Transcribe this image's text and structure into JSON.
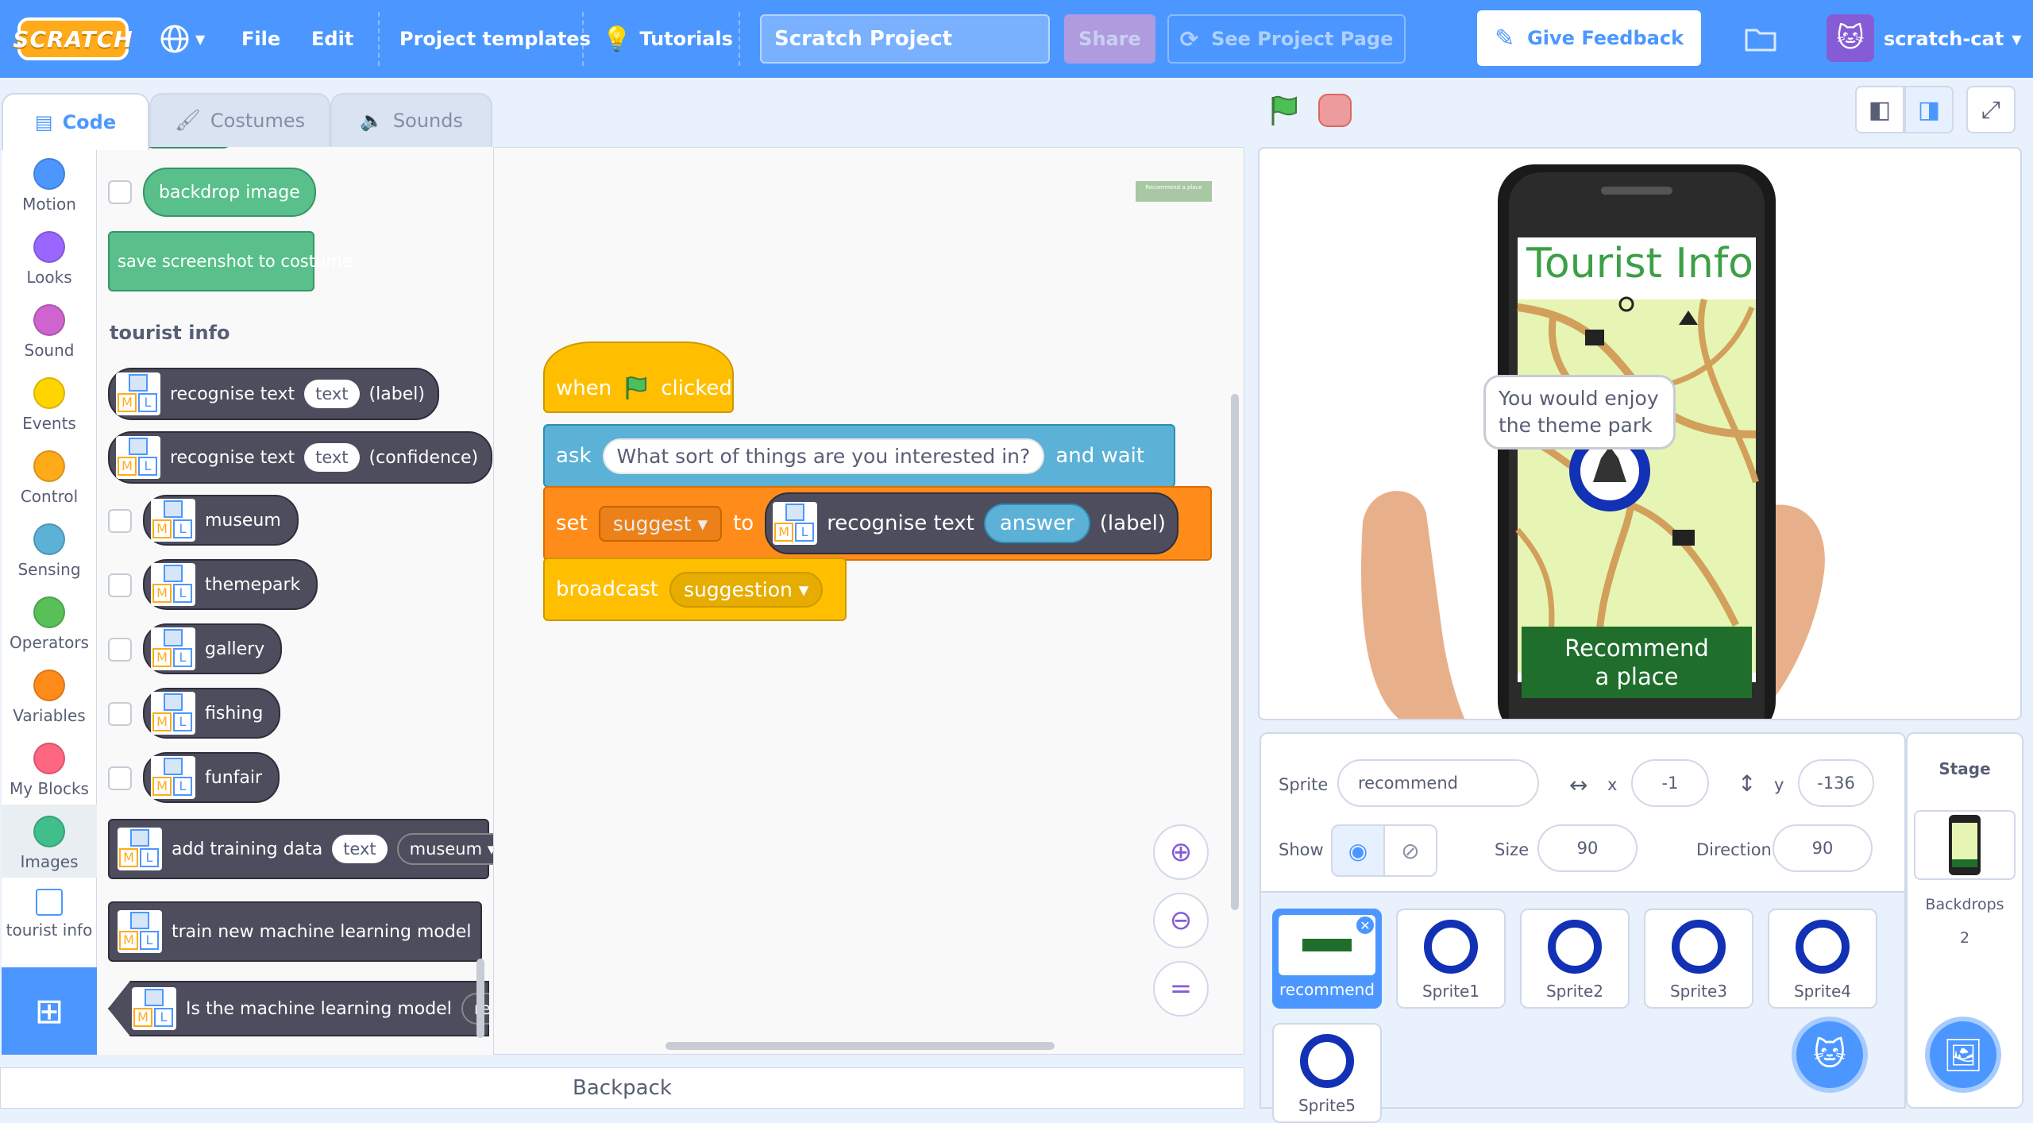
{
  "menubar": {
    "logo": "SCRATCH",
    "file": "File",
    "edit": "Edit",
    "templates": "Project templates",
    "tutorials": "Tutorials",
    "project_title": "Scratch Project",
    "share": "Share",
    "see_project": "See Project Page",
    "feedback": "Give Feedback",
    "username": "scratch-cat"
  },
  "tabs": {
    "code": "Code",
    "costumes": "Costumes",
    "sounds": "Sounds"
  },
  "categories": [
    {
      "label": "Motion",
      "color": "#4c97ff"
    },
    {
      "label": "Looks",
      "color": "#9966ff"
    },
    {
      "label": "Sound",
      "color": "#cf63cf"
    },
    {
      "label": "Events",
      "color": "#ffd500"
    },
    {
      "label": "Control",
      "color": "#ffab19"
    },
    {
      "label": "Sensing",
      "color": "#5cb1d6"
    },
    {
      "label": "Operators",
      "color": "#59c059"
    },
    {
      "label": "Variables",
      "color": "#ff8c1a"
    },
    {
      "label": "My Blocks",
      "color": "#ff6680"
    },
    {
      "label": "Images",
      "color": "#40bf8c"
    },
    {
      "label": "tourist info",
      "color": "#4d4d5e"
    }
  ],
  "palette": {
    "backdrop_image": "backdrop image",
    "save_screenshot": "save screenshot to costume",
    "heading": "tourist info",
    "recognise_label": "recognise text",
    "recognise_input": "text",
    "label_suffix": "(label)",
    "confidence_suffix": "(confidence)",
    "labels": [
      "museum",
      "themepark",
      "gallery",
      "fishing",
      "funfair"
    ],
    "add_training": "add training data",
    "add_training_text": "text",
    "add_training_label": "museum",
    "train_model": "train new machine learning model",
    "is_model": "Is the machine learning model",
    "is_model_dd": "read"
  },
  "script": {
    "hat_when": "when",
    "hat_clicked": "clicked",
    "ask": "ask",
    "ask_question": "What sort of things are you interested in?",
    "ask_wait": "and wait",
    "set": "set",
    "set_var": "suggest",
    "to": "to",
    "recognise": "recognise text",
    "answer": "answer",
    "label": "(label)",
    "broadcast": "broadcast",
    "broadcast_msg": "suggestion",
    "comment_thumb": "Recommend a place"
  },
  "backpack": "Backpack",
  "stage": {
    "title": "Tourist Info",
    "speech": "You would enjoy the theme park",
    "button": "Recommend a place"
  },
  "sprite_info": {
    "sprite_label": "Sprite",
    "sprite_name": "recommend",
    "x_label": "x",
    "x": "-1",
    "y_label": "y",
    "y": "-136",
    "show_label": "Show",
    "size_label": "Size",
    "size": "90",
    "direction_label": "Direction",
    "direction": "90"
  },
  "sprites": [
    "recommend",
    "Sprite1",
    "Sprite2",
    "Sprite3",
    "Sprite4",
    "Sprite5"
  ],
  "stage_pane": {
    "title": "Stage",
    "backdrops_label": "Backdrops",
    "backdrops_count": "2"
  }
}
